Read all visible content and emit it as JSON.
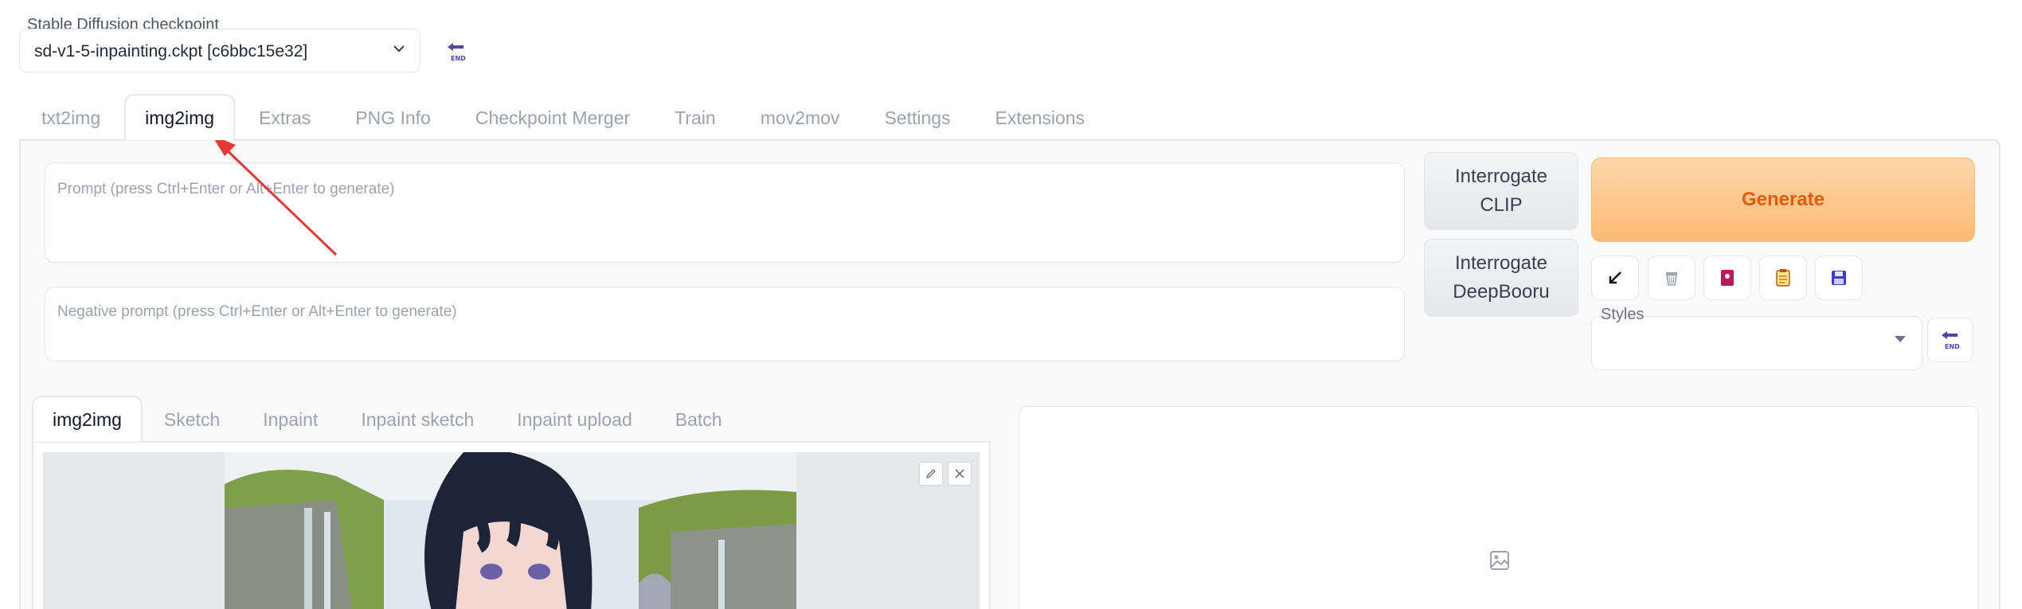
{
  "checkpoint": {
    "label": "Stable Diffusion checkpoint",
    "value": "sd-v1-5-inpainting.ckpt [c6bbc15e32]"
  },
  "top_tabs": [
    "txt2img",
    "img2img",
    "Extras",
    "PNG Info",
    "Checkpoint Merger",
    "Train",
    "mov2mov",
    "Settings",
    "Extensions"
  ],
  "active_top_tab": "img2img",
  "prompt": {
    "placeholder": "Prompt (press Ctrl+Enter or Alt+Enter to generate)",
    "negative_placeholder": "Negative prompt (press Ctrl+Enter or Alt+Enter to generate)"
  },
  "buttons": {
    "interrogate_clip_line1": "Interrogate",
    "interrogate_clip_line2": "CLIP",
    "interrogate_deep_line1": "Interrogate",
    "interrogate_deep_line2": "DeepBooru",
    "generate": "Generate"
  },
  "tool_icons": [
    "arrow-down-left-icon",
    "trash-icon",
    "bookmark-icon",
    "clipboard-icon",
    "save-icon"
  ],
  "styles": {
    "label": "Styles",
    "value": ""
  },
  "sub_tabs": [
    "img2img",
    "Sketch",
    "Inpaint",
    "Inpaint sketch",
    "Inpaint upload",
    "Batch"
  ],
  "active_sub_tab": "img2img",
  "colors": {
    "generate_bg": "#fdba74",
    "generate_text": "#ea580c",
    "annotation_arrow": "#e53935"
  }
}
